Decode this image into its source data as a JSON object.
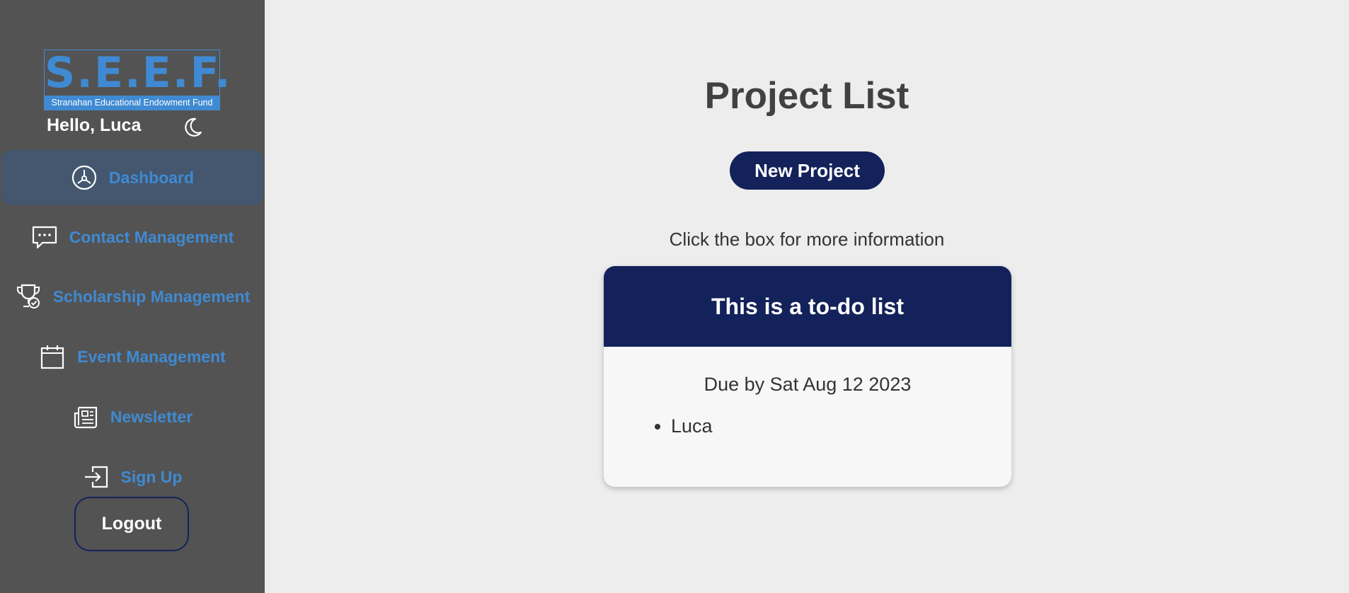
{
  "logo": {
    "letters": "S.E.E.F.",
    "subtitle": "Stranahan Educational Endowment Fund"
  },
  "greeting": "Hello, Luca",
  "nav": [
    {
      "label": "Dashboard",
      "icon": "dashboard-gauge-icon",
      "active": true
    },
    {
      "label": "Contact Management",
      "icon": "chat-bubble-icon"
    },
    {
      "label": "Scholarship Management",
      "icon": "trophy-check-icon"
    },
    {
      "label": "Event Management",
      "icon": "calendar-icon"
    },
    {
      "label": "Newsletter",
      "icon": "newspaper-icon"
    },
    {
      "label": "Sign Up",
      "icon": "sign-in-icon"
    }
  ],
  "logout_label": "Logout",
  "main": {
    "title": "Project List",
    "new_project_label": "New Project",
    "hint": "Click the box for more information"
  },
  "project_card": {
    "title": "This is a to-do list",
    "due": "Due by Sat Aug 12 2023",
    "members": [
      "Luca"
    ]
  },
  "colors": {
    "sidebar_bg": "#535353",
    "accent_blue": "#3f8ad2",
    "navy": "#13225a",
    "page_bg": "#ededed"
  }
}
